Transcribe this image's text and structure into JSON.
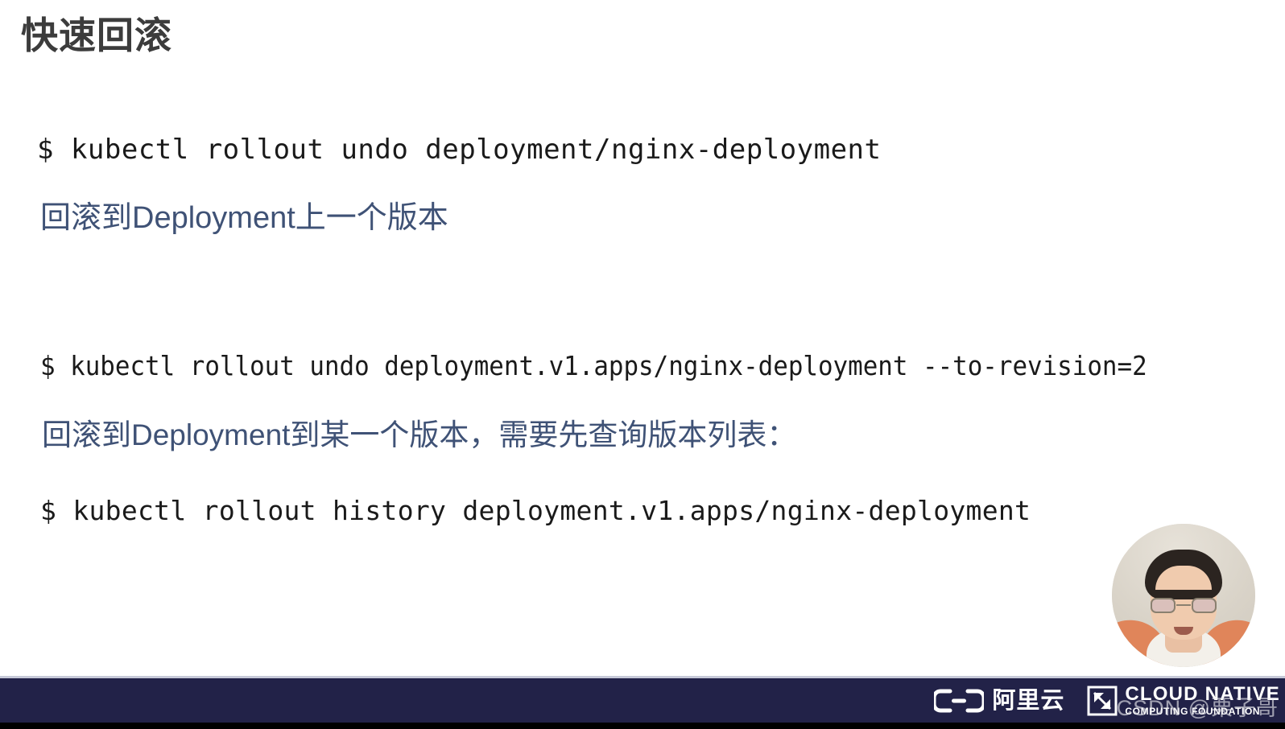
{
  "slide": {
    "title": "快速回滚",
    "background_color": "#ffffff",
    "title_color": "#3c3c3c",
    "command_color": "#1a1a1a",
    "note_color": "#3f5276"
  },
  "body": {
    "command_1": "$ kubectl rollout undo deployment/nginx-deployment",
    "note_1": "回滚到Deployment上一个版本",
    "command_2": "$ kubectl rollout undo deployment.v1.apps/nginx-deployment --to-revision=2",
    "note_2": "回滚到Deployment到某一个版本，需要先查询版本列表：",
    "command_3": "$ kubectl rollout history deployment.v1.apps/nginx-deployment"
  },
  "footer": {
    "background_color": "#222248",
    "aliyun_text": "阿里云",
    "cncf_title": "CLOUD NATIVE",
    "cncf_subtitle": "COMPUTING FOUNDATION"
  },
  "watermark": {
    "text": "CSDN @栗子哥"
  },
  "webcam": {
    "label": "presenter-video"
  }
}
